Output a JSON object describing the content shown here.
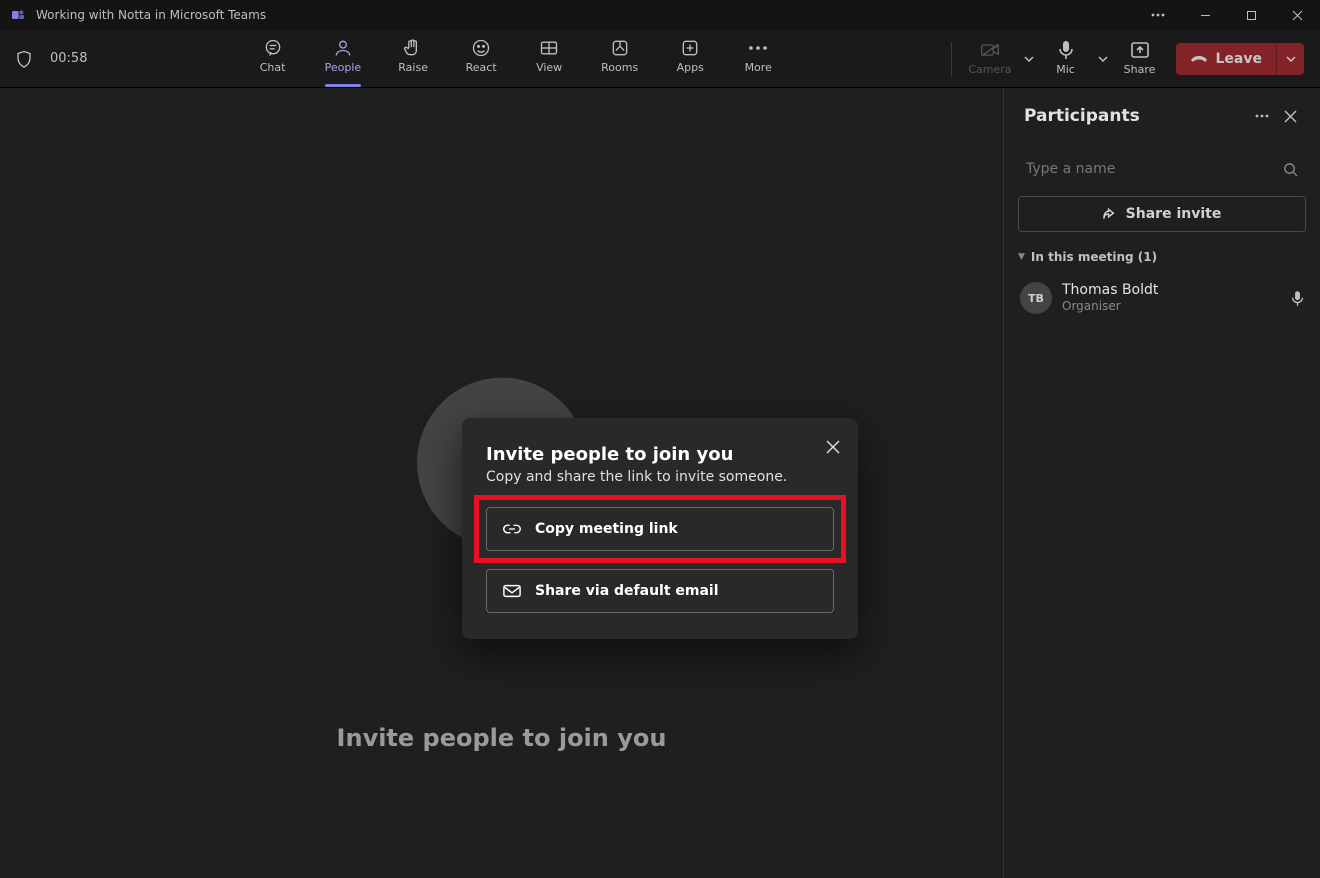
{
  "window": {
    "title": "Working with Notta in Microsoft Teams"
  },
  "toolbar": {
    "timer": "00:58",
    "items": [
      {
        "label": "Chat"
      },
      {
        "label": "People"
      },
      {
        "label": "Raise"
      },
      {
        "label": "React"
      },
      {
        "label": "View"
      },
      {
        "label": "Rooms"
      },
      {
        "label": "Apps"
      },
      {
        "label": "More"
      }
    ],
    "camera_label": "Camera",
    "mic_label": "Mic",
    "share_label": "Share",
    "leave_label": "Leave"
  },
  "panel": {
    "title": "Participants",
    "search_placeholder": "Type a name",
    "share_invite_label": "Share invite",
    "section_label": "In this meeting (1)",
    "participant": {
      "initials": "TB",
      "name": "Thomas Boldt",
      "role": "Organiser"
    }
  },
  "stage": {
    "headline": "Invite people to join you"
  },
  "modal": {
    "title": "Invite people to join you",
    "subtitle": "Copy and share the link to invite someone.",
    "copy_label": "Copy meeting link",
    "email_label": "Share via default email"
  }
}
